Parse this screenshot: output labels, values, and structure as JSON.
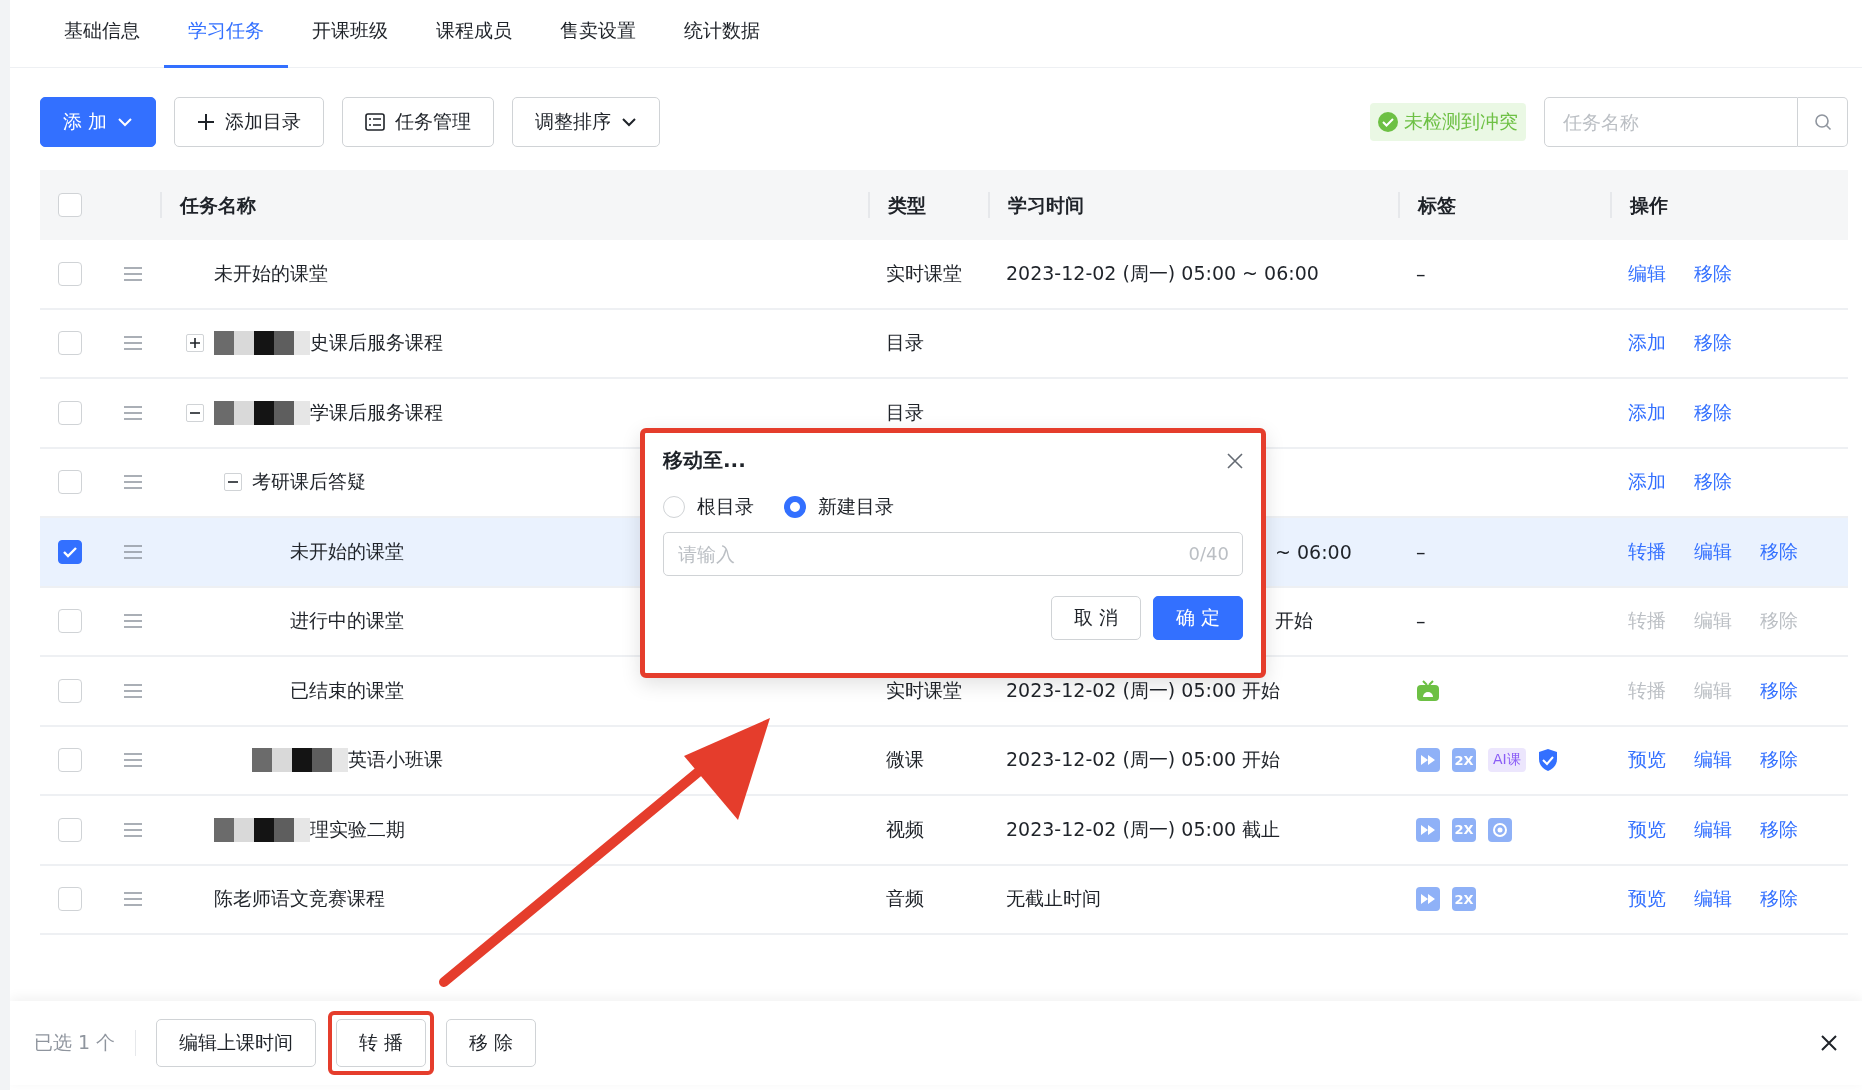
{
  "tabs": [
    {
      "label": "基础信息",
      "selected": false
    },
    {
      "label": "学习任务",
      "selected": true
    },
    {
      "label": "开课班级",
      "selected": false
    },
    {
      "label": "课程成员",
      "selected": false
    },
    {
      "label": "售卖设置",
      "selected": false
    },
    {
      "label": "统计数据",
      "selected": false
    }
  ],
  "toolbar": {
    "buttons": [
      {
        "kind": "primary-dropdown",
        "label": "添 加"
      },
      {
        "kind": "add",
        "label": "添加目录"
      },
      {
        "kind": "list",
        "label": "任务管理"
      },
      {
        "kind": "dropdown",
        "label": "调整排序"
      }
    ],
    "conflict_badge": "未检测到冲突",
    "search": {
      "placeholder": "任务名称"
    }
  },
  "table": {
    "header_checked": false,
    "columns": [
      "任务名称",
      "类型",
      "学习时间",
      "标签",
      "操作"
    ],
    "rows": [
      {
        "name": "未开始的课堂",
        "type": "实时课堂",
        "time": "2023-12-02 (周一) 05:00 ~ 06:00",
        "tag_text": "–",
        "checked": false,
        "actions": [
          {
            "label": "编辑",
            "disabled": false
          },
          {
            "label": "移除",
            "disabled": false
          }
        ]
      },
      {
        "name": "史课后服务课程",
        "redacted": true,
        "expanded": false,
        "type": "目录",
        "checked": false,
        "actions": [
          {
            "label": "添加",
            "disabled": false
          },
          {
            "label": "移除",
            "disabled": false
          }
        ]
      },
      {
        "name": "学课后服务课程",
        "redacted": true,
        "expanded": true,
        "type": "目录",
        "checked": false,
        "actions": [
          {
            "label": "添加",
            "disabled": false
          },
          {
            "label": "移除",
            "disabled": false
          }
        ],
        "children": [
          {
            "name": "考研课后答疑",
            "expanded": true,
            "checked": false,
            "actions": [
              {
                "label": "添加",
                "disabled": false
              },
              {
                "label": "移除",
                "disabled": false
              }
            ],
            "children": [
              {
                "name": "未开始的课堂",
                "time": "~ 06:00",
                "time_cut": true,
                "tag_text": "–",
                "checked": true,
                "actions": [
                  {
                    "label": "转播",
                    "disabled": false
                  },
                  {
                    "label": "编辑",
                    "disabled": false
                  },
                  {
                    "label": "移除",
                    "disabled": false
                  }
                ]
              },
              {
                "name": "进行中的课堂",
                "time": "开始",
                "time_cut": true,
                "tag_text": "–",
                "checked": false,
                "actions": [
                  {
                    "label": "转播",
                    "disabled": true
                  },
                  {
                    "label": "编辑",
                    "disabled": true
                  },
                  {
                    "label": "移除",
                    "disabled": true
                  }
                ]
              },
              {
                "name": "已结束的课堂",
                "type": "实时课堂",
                "time": "2023-12-02 (周一) 05:00 开始",
                "tags": [
                  {
                    "kind": "tv"
                  }
                ],
                "checked": false,
                "actions": [
                  {
                    "label": "转播",
                    "disabled": true
                  },
                  {
                    "label": "编辑",
                    "disabled": true
                  },
                  {
                    "label": "移除",
                    "disabled": false
                  }
                ]
              }
            ]
          },
          {
            "name": "英语小班课",
            "redacted": true,
            "type": "微课",
            "time": "2023-12-02 (周一) 05:00 开始",
            "tags": [
              {
                "kind": "forward"
              },
              {
                "kind": "speed",
                "text": "2X"
              },
              {
                "kind": "ai",
                "text": "AI课"
              },
              {
                "kind": "shield"
              }
            ],
            "checked": false,
            "actions": [
              {
                "label": "预览",
                "disabled": false
              },
              {
                "label": "编辑",
                "disabled": false
              },
              {
                "label": "移除",
                "disabled": false
              }
            ]
          }
        ]
      },
      {
        "name": "理实验二期",
        "redacted": true,
        "type": "视频",
        "time": "2023-12-02 (周一) 05:00 截止",
        "tags": [
          {
            "kind": "forward"
          },
          {
            "kind": "speed",
            "text": "2X"
          },
          {
            "kind": "eye"
          }
        ],
        "checked": false,
        "actions": [
          {
            "label": "预览",
            "disabled": false
          },
          {
            "label": "编辑",
            "disabled": false
          },
          {
            "label": "移除",
            "disabled": false
          }
        ]
      },
      {
        "name": "陈老师语文竞赛课程",
        "type": "音频",
        "time": "无截止时间",
        "tags": [
          {
            "kind": "forward"
          },
          {
            "kind": "speed",
            "text": "2X"
          }
        ],
        "checked": false,
        "actions": [
          {
            "label": "预览",
            "disabled": false
          },
          {
            "label": "编辑",
            "disabled": false
          },
          {
            "label": "移除",
            "disabled": false
          }
        ]
      }
    ]
  },
  "dialog": {
    "title": "移动至...",
    "options": [
      {
        "label": "根目录",
        "selected": false
      },
      {
        "label": "新建目录",
        "selected": true
      }
    ],
    "input": {
      "placeholder": "请输入",
      "counter": "0/40"
    },
    "buttons": [
      {
        "kind": "default",
        "label": "取 消"
      },
      {
        "kind": "primary",
        "label": "确 定"
      }
    ]
  },
  "selection_bar": {
    "count": "已选 1 个",
    "buttons": [
      {
        "label": "编辑上课时间",
        "highlighted": false
      },
      {
        "label": "转 播",
        "highlighted": true
      },
      {
        "label": "移 除",
        "highlighted": false
      }
    ]
  }
}
